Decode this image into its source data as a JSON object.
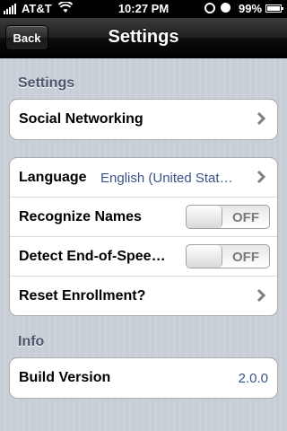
{
  "status_bar": {
    "carrier": "AT&T",
    "time": "10:27 PM",
    "battery": "99%",
    "icons": [
      "signal-icon",
      "wifi-icon",
      "orientation-lock-icon",
      "alarm-icon",
      "battery-icon"
    ],
    "battery_level": 0.99
  },
  "nav": {
    "back_label": "Back",
    "title": "Settings"
  },
  "sections": {
    "settings_header": "Settings",
    "info_header": "Info"
  },
  "group1": {
    "social_networking_label": "Social Networking"
  },
  "group2": {
    "language_label": "Language",
    "language_value": "English (United Stat…",
    "recognize_names_label": "Recognize Names",
    "recognize_names_state": "OFF",
    "detect_end_label": "Detect End-of-Spee…",
    "detect_end_state": "OFF",
    "reset_enrollment_label": "Reset Enrollment?"
  },
  "group3": {
    "build_version_label": "Build Version",
    "build_version_value": "2.0.0"
  },
  "colors": {
    "section_header": "#4c566c",
    "value_text": "#385487",
    "background": "#c5ccd4"
  }
}
